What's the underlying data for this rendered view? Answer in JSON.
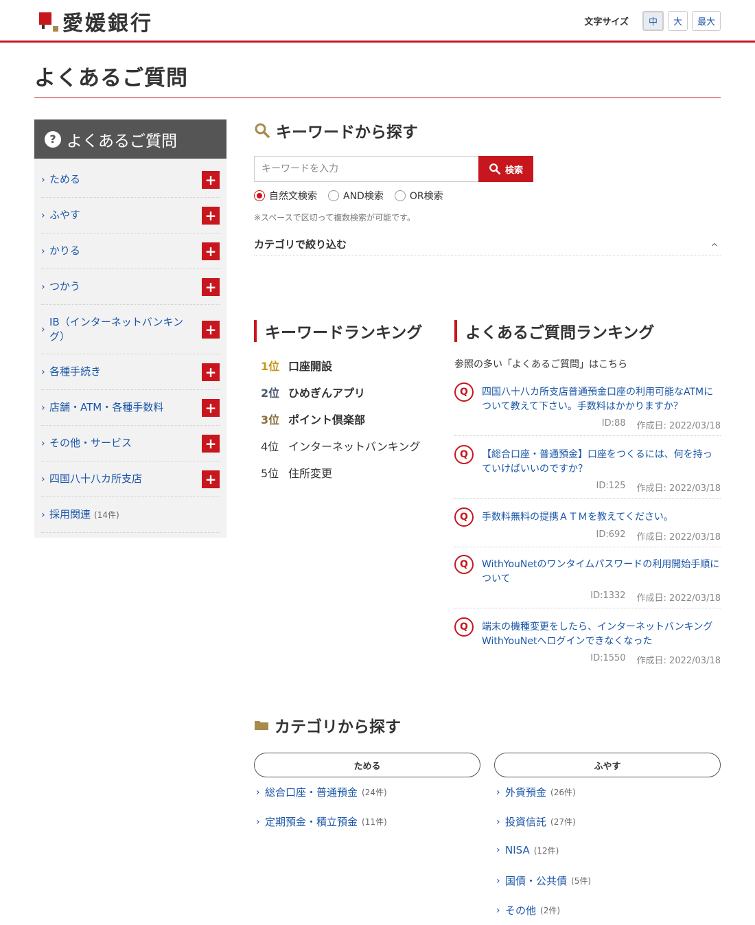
{
  "header": {
    "logo_text": "愛媛銀行",
    "fontsize_label": "文字サイズ",
    "fontsize_options": [
      "中",
      "大",
      "最大"
    ]
  },
  "page_title": "よくあるご質問",
  "sidebar": {
    "title": "よくあるご質問",
    "items": [
      {
        "label": "ためる",
        "count": ""
      },
      {
        "label": "ふやす",
        "count": ""
      },
      {
        "label": "かりる",
        "count": ""
      },
      {
        "label": "つかう",
        "count": ""
      },
      {
        "label": "IB（インターネットバンキング）",
        "count": ""
      },
      {
        "label": "各種手続き",
        "count": ""
      },
      {
        "label": "店舗・ATM・各種手数料",
        "count": ""
      },
      {
        "label": "その他・サービス",
        "count": ""
      },
      {
        "label": "四国八十八カ所支店",
        "count": ""
      },
      {
        "label": "採用関連",
        "count": "(14件)"
      }
    ]
  },
  "search": {
    "title": "キーワードから探す",
    "placeholder": "キーワードを入力",
    "button_label": "検索",
    "modes": [
      "自然文検索",
      "AND検索",
      "OR検索"
    ],
    "note": "※スペースで区切って複数検索が可能です。",
    "category_filter_label": "カテゴリで絞り込む"
  },
  "keyword_ranking": {
    "title": "キーワードランキング",
    "items": [
      {
        "rank": "1位",
        "keyword": "口座開設",
        "color": "#c9961a"
      },
      {
        "rank": "2位",
        "keyword": "ひめぎんアプリ",
        "color": "#4a5a70"
      },
      {
        "rank": "3位",
        "keyword": "ポイント倶楽部",
        "color": "#8b6e3c"
      },
      {
        "rank": "4位",
        "keyword": "インターネットバンキング",
        "color": "#333333"
      },
      {
        "rank": "5位",
        "keyword": "住所変更",
        "color": "#333333"
      }
    ]
  },
  "faq_ranking": {
    "title": "よくあるご質問ランキング",
    "lead": "参照の多い「よくあるご質問」はこちら",
    "q_mark": "Q",
    "items": [
      {
        "question": "四国八十八カ所支店普通預金口座の利用可能なATMについて教えて下さい。手数料はかかりますか？",
        "id": "ID:88",
        "date": "作成日: 2022/03/18"
      },
      {
        "question": "【総合口座・普通預金】口座をつくるには、何を持っていけばいいのですか？",
        "id": "ID:125",
        "date": "作成日: 2022/03/18"
      },
      {
        "question": "手数料無料の提携ＡＴＭを教えてください。",
        "id": "ID:692",
        "date": "作成日: 2022/03/18"
      },
      {
        "question": "WithYouNetのワンタイムパスワードの利用開始手順について",
        "id": "ID:1332",
        "date": "作成日: 2022/03/18"
      },
      {
        "question": "端末の機種変更をしたら、インターネットバンキングWithYouNetへログインできなくなった",
        "id": "ID:1550",
        "date": "作成日: 2022/03/18"
      }
    ]
  },
  "category": {
    "title": "カテゴリから探す",
    "columns": [
      {
        "name": "ためる",
        "links": [
          {
            "name": "総合口座・普通預金",
            "count": "(24件)"
          },
          {
            "name": "定期預金・積立預金",
            "count": "(11件)"
          }
        ]
      },
      {
        "name": "ふやす",
        "links": [
          {
            "name": "外貨預金",
            "count": "(26件)"
          },
          {
            "name": "投資信託",
            "count": "(27件)"
          },
          {
            "name": "NISA",
            "count": "(12件)"
          },
          {
            "name": "国債・公共債",
            "count": "(5件)"
          },
          {
            "name": "その他",
            "count": "(2件)"
          }
        ]
      }
    ]
  },
  "colors": {
    "accent": "#c8161e",
    "link": "#1a56a8",
    "sidebar_head": "#555555",
    "icon_gold": "#a88a4c"
  }
}
